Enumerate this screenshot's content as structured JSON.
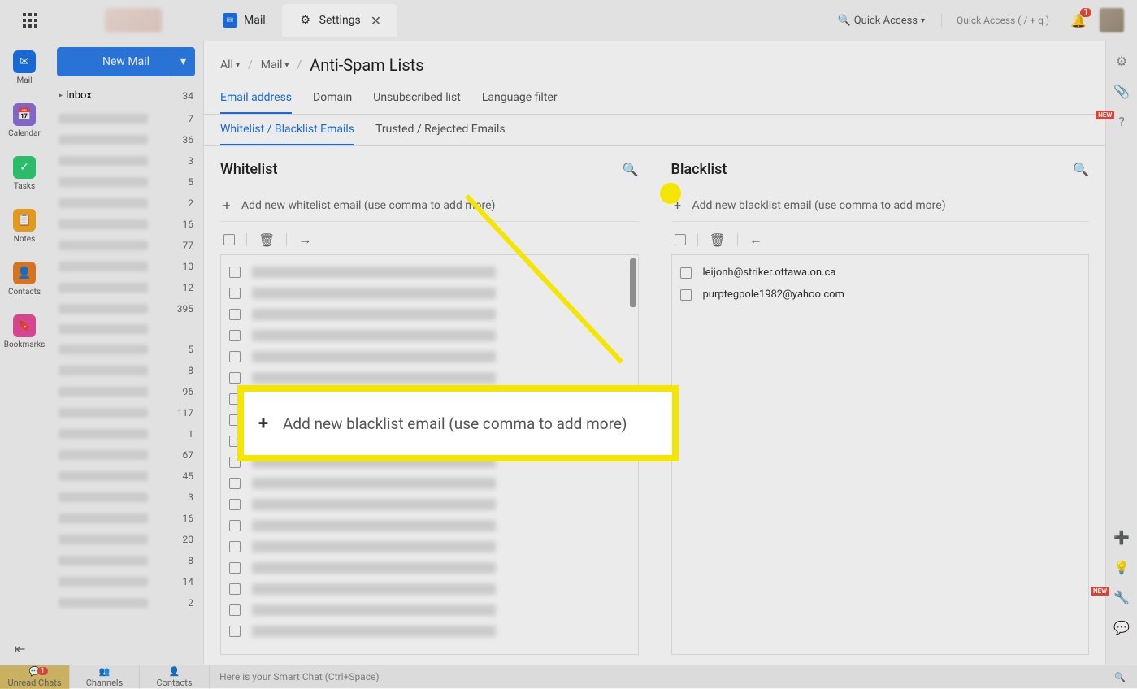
{
  "tabs": {
    "mail": "Mail",
    "settings": "Settings"
  },
  "top": {
    "quickAccess": "Quick Access",
    "quickHint": "Quick Access  ( / + q )",
    "bellCount": "1"
  },
  "rail": {
    "mail": "Mail",
    "calendar": "Calendar",
    "tasks": "Tasks",
    "notes": "Notes",
    "contacts": "Contacts",
    "bookmarks": "Bookmarks"
  },
  "compose": {
    "newMail": "New Mail"
  },
  "folder": {
    "inbox": "Inbox",
    "inboxCount": "34"
  },
  "msgCounts": [
    "7",
    "36",
    "3",
    "5",
    "2",
    "16",
    "77",
    "10",
    "12",
    "395",
    "",
    "5",
    "8",
    "96",
    "117",
    "1",
    "67",
    "45",
    "3",
    "16",
    "20",
    "8",
    "14",
    "2"
  ],
  "breadcrumb": {
    "all": "All",
    "mail": "Mail",
    "title": "Anti-Spam Lists"
  },
  "subnav": {
    "email": "Email address",
    "domain": "Domain",
    "unsub": "Unsubscribed list",
    "lang": "Language filter"
  },
  "subnav2": {
    "wlbl": "Whitelist / Blacklist Emails",
    "tr": "Trusted / Rejected Emails"
  },
  "whitelist": {
    "title": "Whitelist",
    "placeholder": "Add new whitelist email (use comma to add more)"
  },
  "blacklist": {
    "title": "Blacklist",
    "placeholder": "Add new blacklist email (use comma to add more)",
    "items": [
      "leijonh@striker.ottawa.on.ca",
      "purptegpole1982@yahoo.com"
    ]
  },
  "whitelist_rows": 18,
  "bottom": {
    "unread": "Unread Chats",
    "unreadBadge": "1",
    "channels": "Channels",
    "contacts": "Contacts",
    "smart": "Here is your Smart Chat (Ctrl+Space)"
  },
  "callout": {
    "text": "Add new blacklist email (use comma to add more)"
  }
}
